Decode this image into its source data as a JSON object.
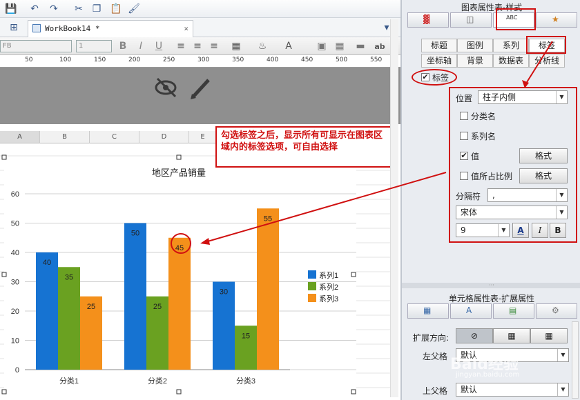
{
  "toolbar": {
    "workbook_tab": "WorkBook14 *",
    "close": "×",
    "font_name": "FB",
    "font_size": "1",
    "bold": "B",
    "italic": "I",
    "underline": "U",
    "ab": "ab"
  },
  "ruler": {
    "ticks": [
      "50",
      "100",
      "150",
      "200",
      "250",
      "300",
      "350",
      "400",
      "450",
      "500",
      "550"
    ]
  },
  "columns": [
    "A",
    "B",
    "C",
    "D",
    "E"
  ],
  "chart_data": {
    "type": "bar",
    "title": "地区产品销量",
    "categories": [
      "分类1",
      "分类2",
      "分类3"
    ],
    "series": [
      {
        "name": "系列1",
        "values": [
          40,
          50,
          30
        ],
        "color": "#1673d2"
      },
      {
        "name": "系列2",
        "values": [
          35,
          25,
          15
        ],
        "color": "#6aa121"
      },
      {
        "name": "系列3",
        "values": [
          25,
          45,
          55
        ],
        "color": "#f4901b"
      }
    ],
    "ylim": [
      0,
      60
    ],
    "yticks": [
      "0",
      "10",
      "20",
      "30",
      "40",
      "50",
      "60"
    ],
    "legend": "right",
    "grid": true
  },
  "callout": {
    "text": "勾选标签之后，显示所有可显示在图表区域内的标签选项，可自由选择"
  },
  "panel": {
    "title": "图表属性表-样式",
    "tabs_row1": [
      "标题",
      "图例",
      "系列",
      "标签"
    ],
    "tabs_row2": [
      "坐标轴",
      "背景",
      "数据表",
      "分析线"
    ],
    "label_checkbox": "标签",
    "position_label": "位置",
    "position_value": "柱子内侧",
    "opt_category": "分类名",
    "opt_series": "系列名",
    "opt_value": "值",
    "opt_percent": "值所占比例",
    "format_btn": "格式",
    "separator_label": "分隔符",
    "separator_value": ",",
    "font_value": "宋体",
    "font_size": "9",
    "bold": "B",
    "italic": "I",
    "font_color": "A"
  },
  "panel2": {
    "title": "单元格属性表-扩展属性",
    "expand_label": "扩展方向:",
    "left_parent": "左父格",
    "left_value": "默认",
    "top_parent": "上父格",
    "top_value": "默认"
  },
  "watermark": "Baid经验",
  "watermark_url": "jingyan.baidu.com"
}
